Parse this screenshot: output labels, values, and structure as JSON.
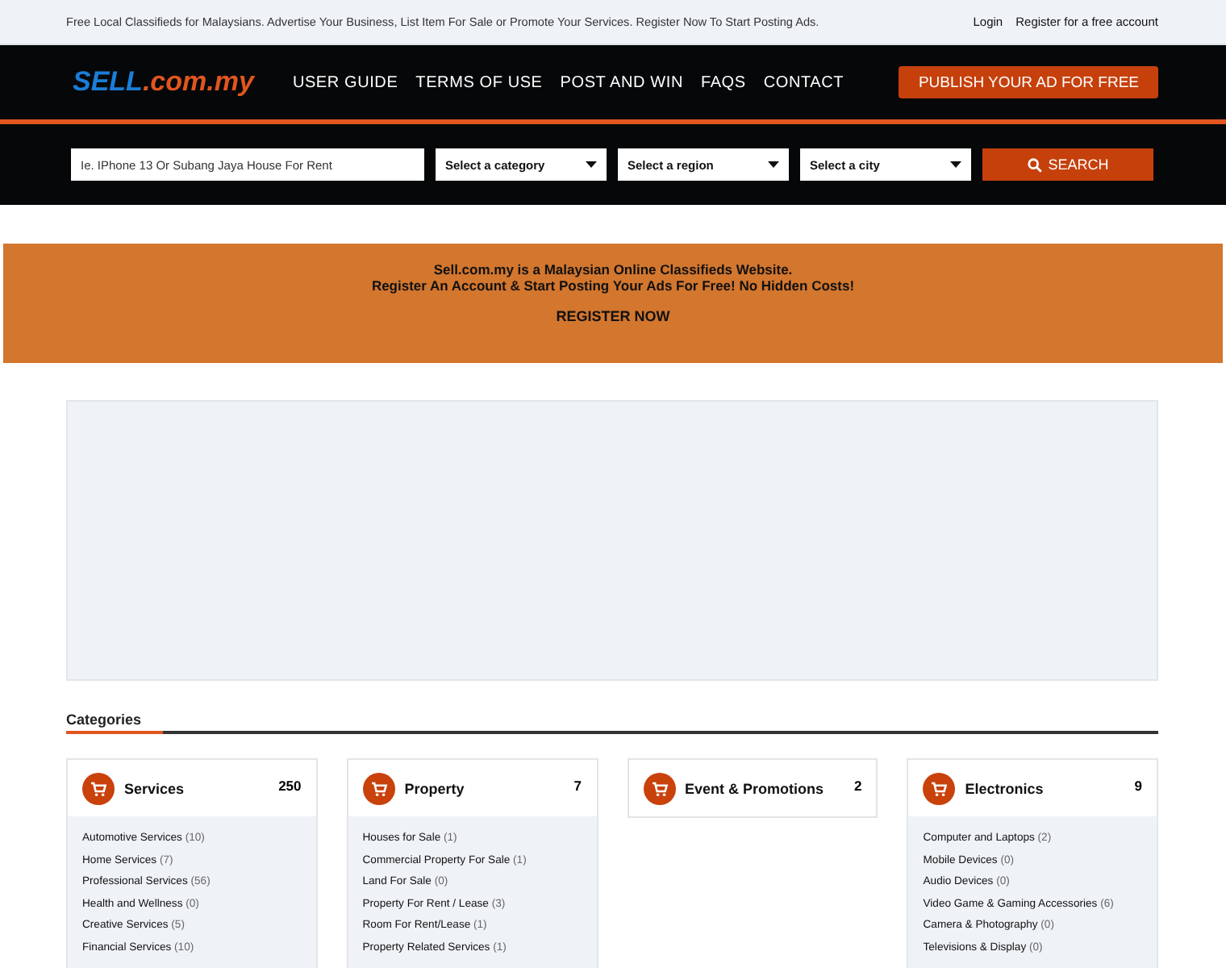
{
  "top_bar": {
    "tagline": "Free Local Classifieds for Malaysians. Advertise Your Business, List Item For Sale or Promote Your Services. Register Now To Start Posting Ads.",
    "links": [
      "Login",
      "Register for a free account"
    ]
  },
  "header": {
    "logo": {
      "brand": "SELL",
      "suffix": ".com.my"
    },
    "nav": [
      "USER GUIDE",
      "TERMS OF USE",
      "POST AND WIN",
      "FAQS",
      "CONTACT"
    ],
    "publish_button": "PUBLISH YOUR AD FOR FREE"
  },
  "search": {
    "placeholder": "Ie. IPhone 13 Or Subang Jaya House For Rent",
    "selects": [
      "Select a category",
      "Select a region",
      "Select a city"
    ],
    "button": "SEARCH"
  },
  "banner": {
    "lines": [
      "Sell.com.my is a Malaysian Online Classifieds Website.",
      "Register An Account & Start Posting Your Ads For Free! No Hidden Costs!"
    ],
    "link": "REGISTER NOW"
  },
  "categories": {
    "title": "Categories",
    "cards": [
      {
        "name": "Services",
        "count": "250",
        "items": [
          {
            "name": "Automotive Services",
            "count": "(10)"
          },
          {
            "name": "Home Services",
            "count": "(7)"
          },
          {
            "name": "Professional Services",
            "count": "(56)"
          },
          {
            "name": "Health and Wellness",
            "count": "(0)"
          },
          {
            "name": "Creative Services",
            "count": "(5)"
          },
          {
            "name": "Financial Services",
            "count": "(10)"
          }
        ]
      },
      {
        "name": "Property",
        "count": "7",
        "items": [
          {
            "name": "Houses for Sale",
            "count": "(1)"
          },
          {
            "name": "Commercial Property For Sale",
            "count": "(1)"
          },
          {
            "name": "Land For Sale",
            "count": "(0)"
          },
          {
            "name": "Property For Rent / Lease",
            "count": "(3)"
          },
          {
            "name": "Room For Rent/Lease",
            "count": "(1)"
          },
          {
            "name": "Property Related Services",
            "count": "(1)"
          }
        ]
      },
      {
        "name": "Event & Promotions",
        "count": "2"
      },
      {
        "name": "Electronics",
        "count": "9",
        "items": [
          {
            "name": "Computer and Laptops",
            "count": "(2)"
          },
          {
            "name": "Mobile Devices",
            "count": "(0)"
          },
          {
            "name": "Audio Devices",
            "count": "(0)"
          },
          {
            "name": "Video Game & Gaming Accessories",
            "count": "(6)"
          },
          {
            "name": "Camera & Photography",
            "count": "(0)"
          },
          {
            "name": "Televisions & Display",
            "count": "(0)"
          }
        ]
      }
    ]
  }
}
